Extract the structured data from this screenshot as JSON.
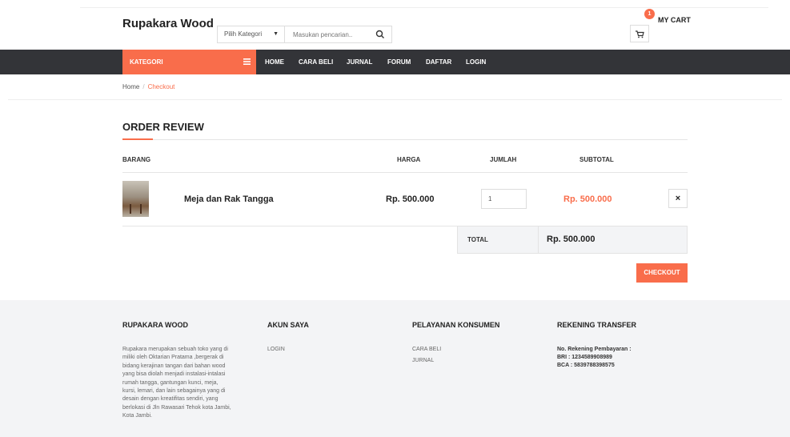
{
  "brand": {
    "name": "Rupakara Wood",
    "accent_color": "#f96d4b",
    "nav_bg": "#333438"
  },
  "search": {
    "category_label": "Pilih Kategori",
    "placeholder": "Masukan pencarian..",
    "icon": "search-icon"
  },
  "cart": {
    "badge_count": "1",
    "label": "MY CART",
    "icon": "cart-icon"
  },
  "nav": {
    "category_button": "KATEGORI",
    "items": [
      "HOME",
      "CARA BELI",
      "JURNAL",
      "FORUM",
      "DAFTAR",
      "LOGIN"
    ]
  },
  "breadcrumb": {
    "home": "Home",
    "separator": "/",
    "current": "Checkout"
  },
  "order": {
    "title": "ORDER REVIEW",
    "headers": {
      "item": "BARANG",
      "price": "HARGA",
      "qty": "JUMLAH",
      "subtotal": "SUBTOTAL"
    },
    "items": [
      {
        "name": "Meja dan Rak Tangga",
        "price": "Rp. 500.000",
        "qty": "1",
        "subtotal": "Rp. 500.000"
      }
    ],
    "total_label": "TOTAL",
    "total_value": "Rp. 500.000",
    "checkout_label": "CHECKOUT",
    "remove_symbol": "×"
  },
  "footer": {
    "about": {
      "title": "RUPAKARA WOOD",
      "lines": [
        "Rupakara merupakan sebuah toko yang di",
        "miliki oleh Oktarian Pratama ,bergerak di",
        "bidang kerajinan tangan dari bahan wood",
        "yang bisa diolah menjadi instalasi-intalasi",
        "rumah tangga, gantungan kunci, meja,",
        "kursi, lemari, dan lain sebagainya yang di",
        "desain dengan kreatifitas sendiri, yang",
        "berlokasi di Jln Rawasari Tehok kota Jambi,",
        "Kota Jambi."
      ]
    },
    "account": {
      "title": "AKUN SAYA",
      "links": [
        "LOGIN"
      ]
    },
    "service": {
      "title": "PELAYANAN KONSUMEN",
      "links": [
        "CARA BELI",
        "JURNAL"
      ]
    },
    "transfer": {
      "title": "REKENING TRANSFER",
      "lines": [
        "No. Rekening Pembayaran :",
        "BRI : 1234589908989",
        "BCA : 5839788398575"
      ]
    }
  }
}
